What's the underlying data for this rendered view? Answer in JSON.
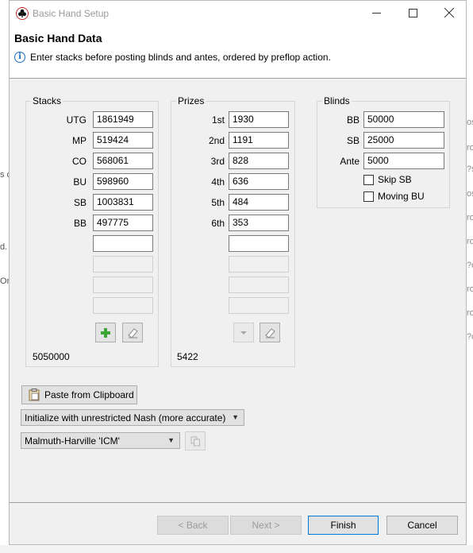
{
  "window": {
    "title": "Basic Hand Setup"
  },
  "header": {
    "title": "Basic Hand Data",
    "info": "Enter stacks before posting blinds and antes, ordered by preflop action."
  },
  "stacks": {
    "label": "Stacks",
    "rows": [
      {
        "pos": "UTG",
        "value": "1861949"
      },
      {
        "pos": "MP",
        "value": "519424"
      },
      {
        "pos": "CO",
        "value": "568061"
      },
      {
        "pos": "BU",
        "value": "598960"
      },
      {
        "pos": "SB",
        "value": "1003831"
      },
      {
        "pos": "BB",
        "value": "497775"
      }
    ],
    "total": "5050000"
  },
  "prizes": {
    "label": "Prizes",
    "rows": [
      {
        "place": "1st",
        "value": "1930"
      },
      {
        "place": "2nd",
        "value": "1191"
      },
      {
        "place": "3rd",
        "value": "828"
      },
      {
        "place": "4th",
        "value": "636"
      },
      {
        "place": "5th",
        "value": "484"
      },
      {
        "place": "6th",
        "value": "353"
      }
    ],
    "total": "5422"
  },
  "blinds": {
    "label": "Blinds",
    "bb_label": "BB",
    "bb_value": "50000",
    "sb_label": "SB",
    "sb_value": "25000",
    "ante_label": "Ante",
    "ante_value": "5000",
    "skip_sb": "Skip SB",
    "moving_bu": "Moving BU"
  },
  "actions": {
    "paste": "Paste from Clipboard",
    "init_select": "Initialize with unrestricted Nash (more accurate)",
    "icm_select": "Malmuth-Harville 'ICM'"
  },
  "footer": {
    "back": "< Back",
    "next": "Next >",
    "finish": "Finish",
    "cancel": "Cancel"
  },
  "background_fragments": {
    "right": [
      "os",
      "ro",
      "?s",
      "os",
      "ro",
      "ro",
      "?o",
      "ro",
      "ro",
      "?o"
    ],
    "left": [
      "s c",
      "d.",
      "On"
    ]
  },
  "colors": {
    "accent": "#0078d7",
    "info": "#1a6fc4",
    "add_icon": "#3aa637"
  }
}
